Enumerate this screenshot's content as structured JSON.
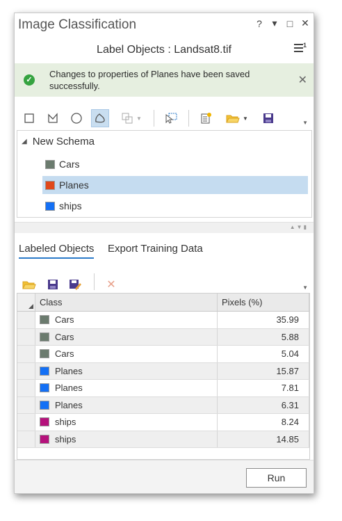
{
  "window": {
    "title": "Image Classification",
    "controls": [
      "?",
      "▾",
      "□",
      "✕"
    ]
  },
  "header": {
    "subtitle": "Label Objects : Landsat8.tif",
    "menu_badge": "1"
  },
  "notification": {
    "message": "Changes to properties of Planes have been saved successfully.",
    "status_color": "#35a340"
  },
  "schema": {
    "root_label": "New Schema",
    "items": [
      {
        "label": "Cars",
        "color": "#6b7b6e",
        "selected": false
      },
      {
        "label": "Planes",
        "color": "#e0481a",
        "selected": true
      },
      {
        "label": "ships",
        "color": "#1470f5",
        "selected": false
      }
    ]
  },
  "tabs": [
    {
      "label": "Labeled Objects",
      "active": true
    },
    {
      "label": "Export Training Data",
      "active": false
    }
  ],
  "table": {
    "columns": [
      "Class",
      "Pixels (%)"
    ],
    "rows": [
      {
        "class": "Cars",
        "color": "#6b7b6e",
        "pixels": "35.99"
      },
      {
        "class": "Cars",
        "color": "#6b7b6e",
        "pixels": "5.88"
      },
      {
        "class": "Cars",
        "color": "#6b7b6e",
        "pixels": "5.04"
      },
      {
        "class": "Planes",
        "color": "#1470f5",
        "pixels": "15.87"
      },
      {
        "class": "Planes",
        "color": "#1470f5",
        "pixels": "7.81"
      },
      {
        "class": "Planes",
        "color": "#1470f5",
        "pixels": "6.31"
      },
      {
        "class": "ships",
        "color": "#b5127c",
        "pixels": "8.24"
      },
      {
        "class": "ships",
        "color": "#b5127c",
        "pixels": "14.85"
      }
    ]
  },
  "footer": {
    "run_label": "Run"
  },
  "colors": {
    "accent": "#2a7ac9",
    "selection": "#c5dcf0",
    "notice_bg": "#e6efe0"
  }
}
